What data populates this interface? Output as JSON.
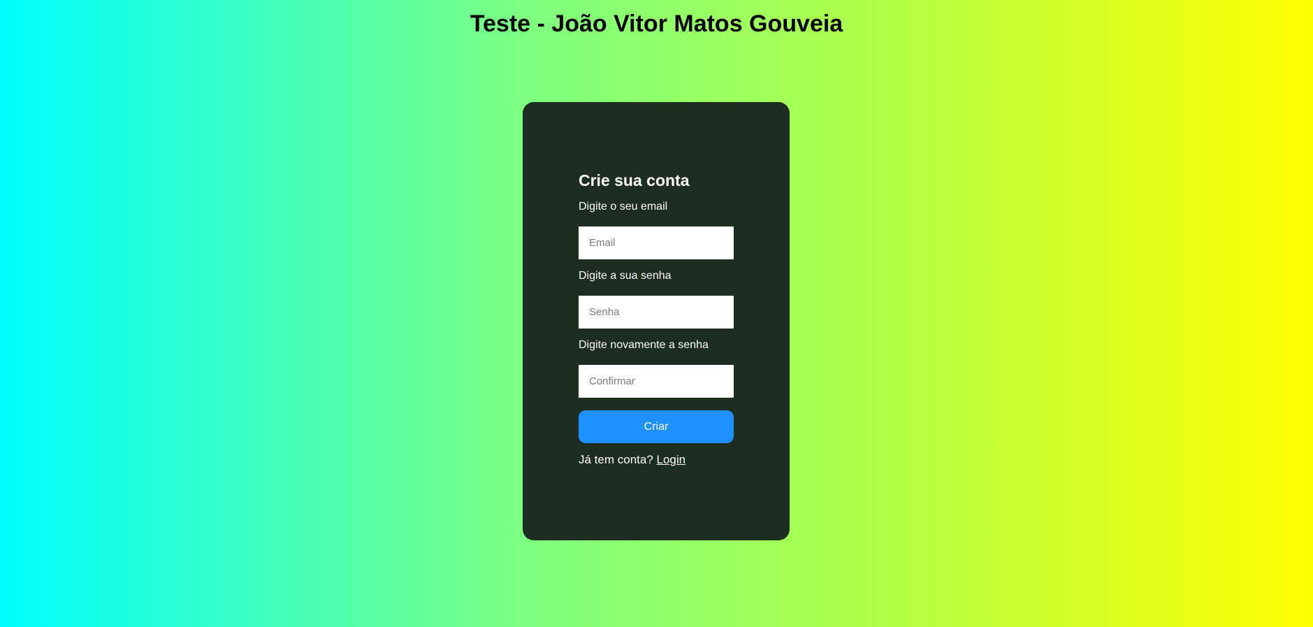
{
  "page": {
    "title": "Teste - João Vitor Matos Gouveia"
  },
  "form": {
    "heading": "Crie sua conta",
    "email_label": "Digite o seu email",
    "email_placeholder": "Email",
    "email_value": "",
    "password_label": "Digite a sua senha",
    "password_placeholder": "Senha",
    "password_value": "",
    "confirm_label": "Digite novamente a senha",
    "confirm_placeholder": "Confirmar",
    "confirm_value": "",
    "submit_label": "Criar",
    "login_prompt": "Já tem conta?",
    "login_link": "Login"
  },
  "colors": {
    "gradient_start": "#00ffff",
    "gradient_end": "#ffff00",
    "card_background": "#1d2d1f",
    "button": "#1e90ff",
    "text_light": "#ffffff",
    "title_text": "#000000"
  }
}
